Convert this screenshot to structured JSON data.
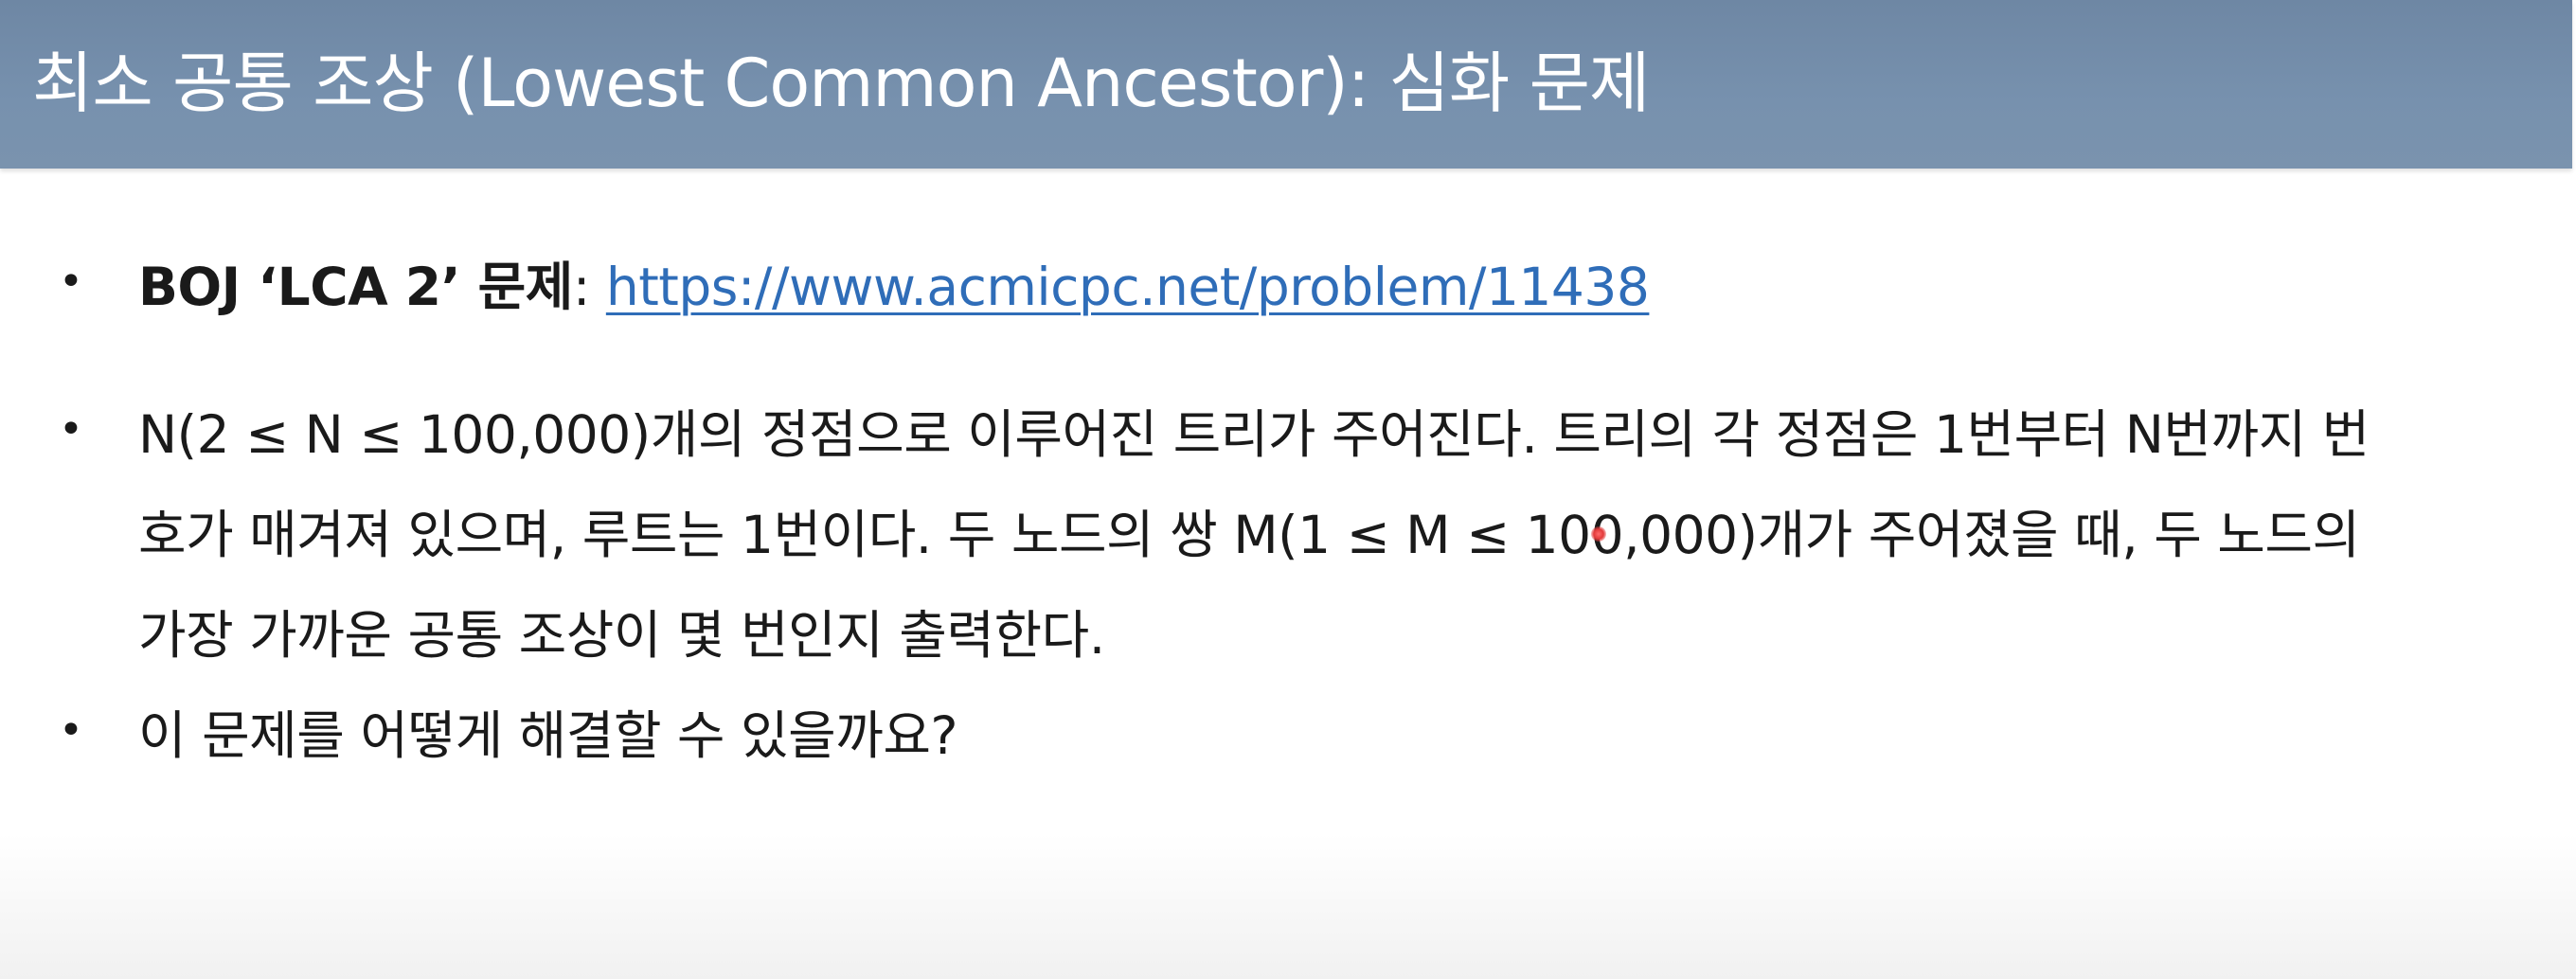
{
  "header": {
    "title": "최소 공통 조상 (Lowest Common Ancestor): 심화 문제"
  },
  "bullets": [
    {
      "marker": "•",
      "bold_label": "BOJ ‘LCA 2’ 문제",
      "separator": ": ",
      "link": "https://www.acmicpc.net/problem/11438"
    },
    {
      "marker": "•",
      "lines": [
        "N(2 ≤ N ≤ 100,000)개의 정점으로 이루어진 트리가 주어진다. 트리의 각 정점은 1번부터 N번까지 번",
        "호가 매겨져 있으며, 루트는 1번이다. 두 노드의 쌍 M(1 ≤ M ≤ 100,000)개가 주어졌을 때, 두 노드의",
        "가장 가까운 공통 조상이 몇 번인지 출력한다."
      ]
    },
    {
      "marker": "•",
      "text": "이 문제를 어떻게 해결할 수 있을까요?"
    }
  ],
  "colors": {
    "header_bg": "#7790ad",
    "header_text": "#ffffff",
    "link": "#2f6db8",
    "body_text": "#1a1a1a",
    "pointer": "#e23a3a"
  }
}
